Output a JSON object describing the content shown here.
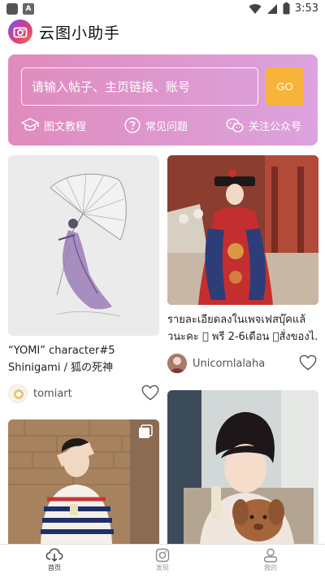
{
  "status_bar": {
    "time": "3:53",
    "notif_badge": "A"
  },
  "header": {
    "app_title": "云图小助手"
  },
  "search": {
    "placeholder": "请输入帖子、主页链接、账号",
    "go_label": "GO"
  },
  "quick_links": [
    {
      "label": "图文教程",
      "icon": "graduation-cap-icon"
    },
    {
      "label": "常见问题",
      "icon": "question-circle-icon"
    },
    {
      "label": "关注公众号",
      "icon": "wechat-icon"
    }
  ],
  "feed": [
    {
      "title_line1": "“YOMI” character#5",
      "title_line2": "Shinigami / 狐の死神",
      "author": "tomiart"
    },
    {
      "title_line1": "รายละเอียดลงในเพจเฟสบุ๊คแล้",
      "title_line2": "วนะคะ 􀀀 พรี 2-6เดือน 􀀀สั่งของไ...",
      "author": "Unicornlalaha"
    },
    {
      "title_line1": "",
      "title_line2": "",
      "author": ""
    },
    {
      "title_line1": "",
      "title_line2": "",
      "author": ""
    }
  ],
  "bottom_nav": [
    {
      "label": "首页",
      "icon": "cloud-download-icon",
      "active": true
    },
    {
      "label": "发现",
      "icon": "instagram-icon",
      "active": false
    },
    {
      "label": "我的",
      "icon": "user-icon",
      "active": false
    }
  ],
  "colors": {
    "panel_start": "#e08bbd",
    "panel_end": "#dca3de",
    "go_button": "#f8b43a"
  }
}
